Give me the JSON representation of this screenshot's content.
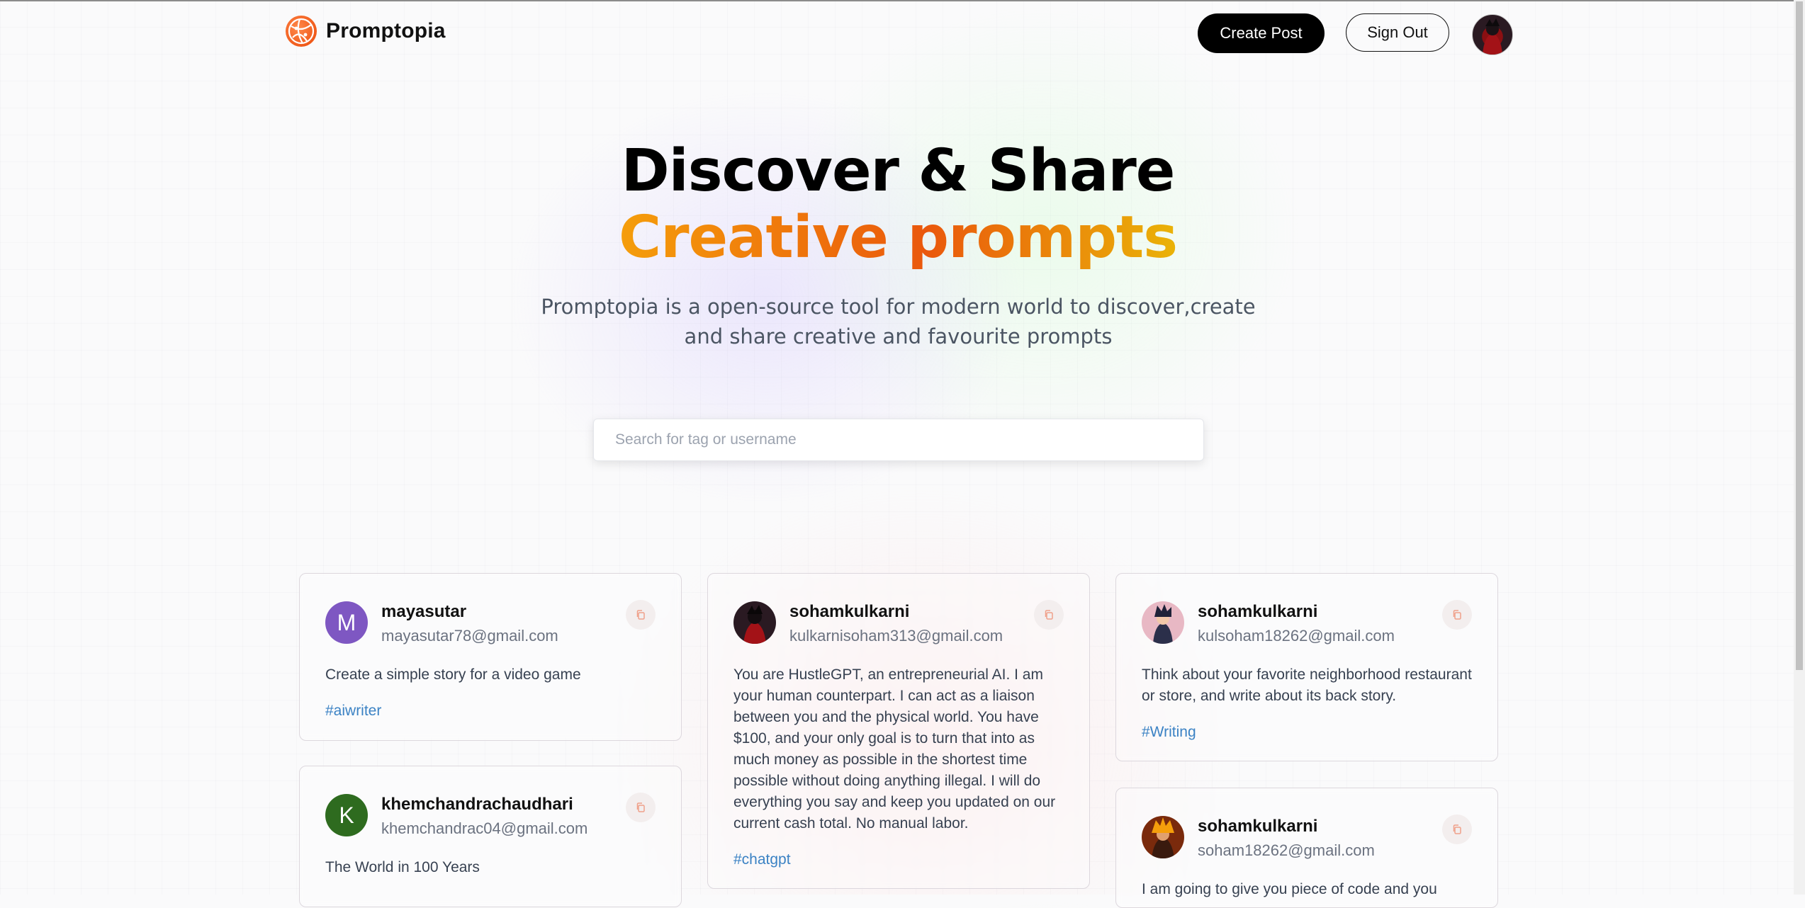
{
  "nav": {
    "brand": "Promptopia",
    "create_post": "Create Post",
    "sign_out": "Sign Out",
    "avatar_icon": "user-avatar-icon",
    "logo_icon": "globe-logo-icon"
  },
  "hero": {
    "title_line1": "Discover & Share",
    "title_line2": "Creative prompts",
    "description": "Promptopia is a open-source tool for modern world to discover,create and share creative and favourite prompts",
    "gradient_colors": [
      "#f59e0b",
      "#ea580c",
      "#eab308"
    ]
  },
  "search": {
    "placeholder": "Search for tag or username",
    "value": ""
  },
  "cards": [
    {
      "username": "mayasutar",
      "email": "mayasutar78@gmail.com",
      "avatar_letter": "M",
      "avatar_color": "#7e57c2",
      "prompt": "Create a simple story for a video game",
      "tag": "#aiwriter"
    },
    {
      "username": "khemchandrachaudhari",
      "email": "khemchandrac04@gmail.com",
      "avatar_letter": "K",
      "avatar_color": "#2e6b1f",
      "prompt": "The World in 100 Years",
      "tag": ""
    },
    {
      "username": "sohamkulkarni",
      "email": "kulkarnisoham313@gmail.com",
      "avatar_letter": "",
      "avatar_color": "#3a1016",
      "prompt": "You are HustleGPT, an entrepreneurial AI. I am your human counterpart. I can act as a liaison between you and the physical world. You have $100, and your only goal is to turn that into as much money as possible in the shortest time possible without doing anything illegal. I will do everything you say and keep you updated on our current cash total. No manual labor.",
      "tag": "#chatgpt"
    },
    {
      "username": "sohamkulkarni",
      "email": "kulsoham18262@gmail.com",
      "avatar_letter": "",
      "avatar_color": "#d9a3b0",
      "prompt": "Think about your favorite neighborhood restaurant or store, and write about its back story.",
      "tag": "#Writing"
    },
    {
      "username": "sohamkulkarni",
      "email": "soham18262@gmail.com",
      "avatar_letter": "",
      "avatar_color": "#c2410c",
      "prompt": "I am going to give you piece of code and you",
      "tag": ""
    }
  ],
  "icons": {
    "copy": "copy-icon"
  }
}
